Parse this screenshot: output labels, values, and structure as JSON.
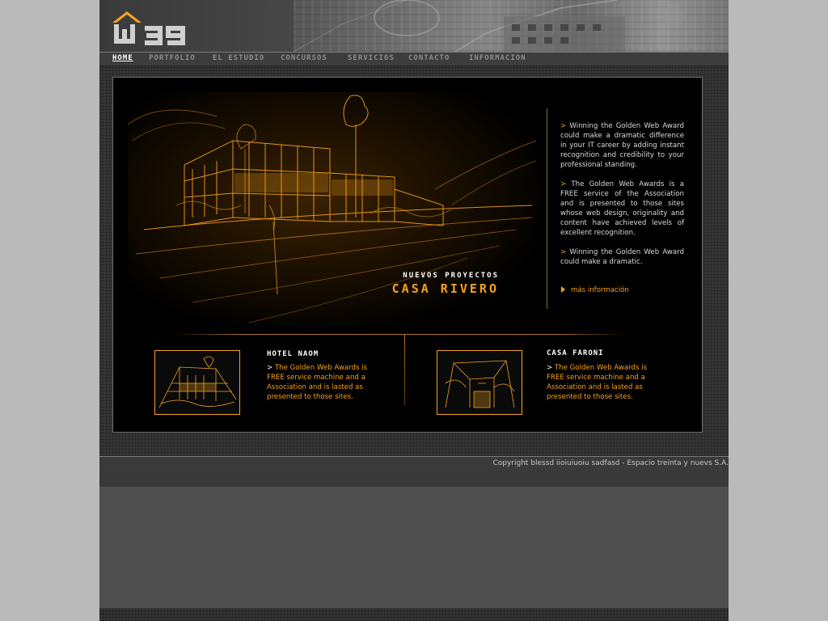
{
  "brand": {
    "logo_text": "W39",
    "accent": "#f6a21e"
  },
  "nav": {
    "items": [
      {
        "label": "HOME",
        "active": true
      },
      {
        "label": "PORTFOLIO",
        "active": false
      },
      {
        "label": "EL ESTUDIO",
        "active": false
      },
      {
        "label": "CONCURSOS",
        "active": false
      },
      {
        "label": "SERVICIOS",
        "active": false
      },
      {
        "label": "CONTACTO",
        "active": false
      },
      {
        "label": "INFORMACION",
        "active": false
      }
    ]
  },
  "hero": {
    "subtitle": "NUEVOS PROYECTOS",
    "title": "CASA RIVERO"
  },
  "news": {
    "paragraphs": [
      "Winning the Golden Web Award could make a dramatic difference in your IT career by adding instant recognition and credibility to your professional standing.",
      "The Golden Web Awards is a FREE service of the Association and is presented to those sites whose web design, originality and content have achieved levels of excellent recognition.",
      "Winning the Golden Web Award could make a dramatic."
    ],
    "more_label": "más información"
  },
  "projects": [
    {
      "title": "HOTEL NAOM",
      "description": "The Golden Web Awards is FREE service machine and a Association and is lasted as presented to those sites."
    },
    {
      "title": "CASA FARONI",
      "description": "The Golden Web Awards is FREE service machine  and a Association and is lasted as presented to those sites."
    }
  ],
  "footer": {
    "copyright": "Copyright blessd iioiuiuoiu sadfasd - Espacio treinta y nuevs S.A."
  }
}
